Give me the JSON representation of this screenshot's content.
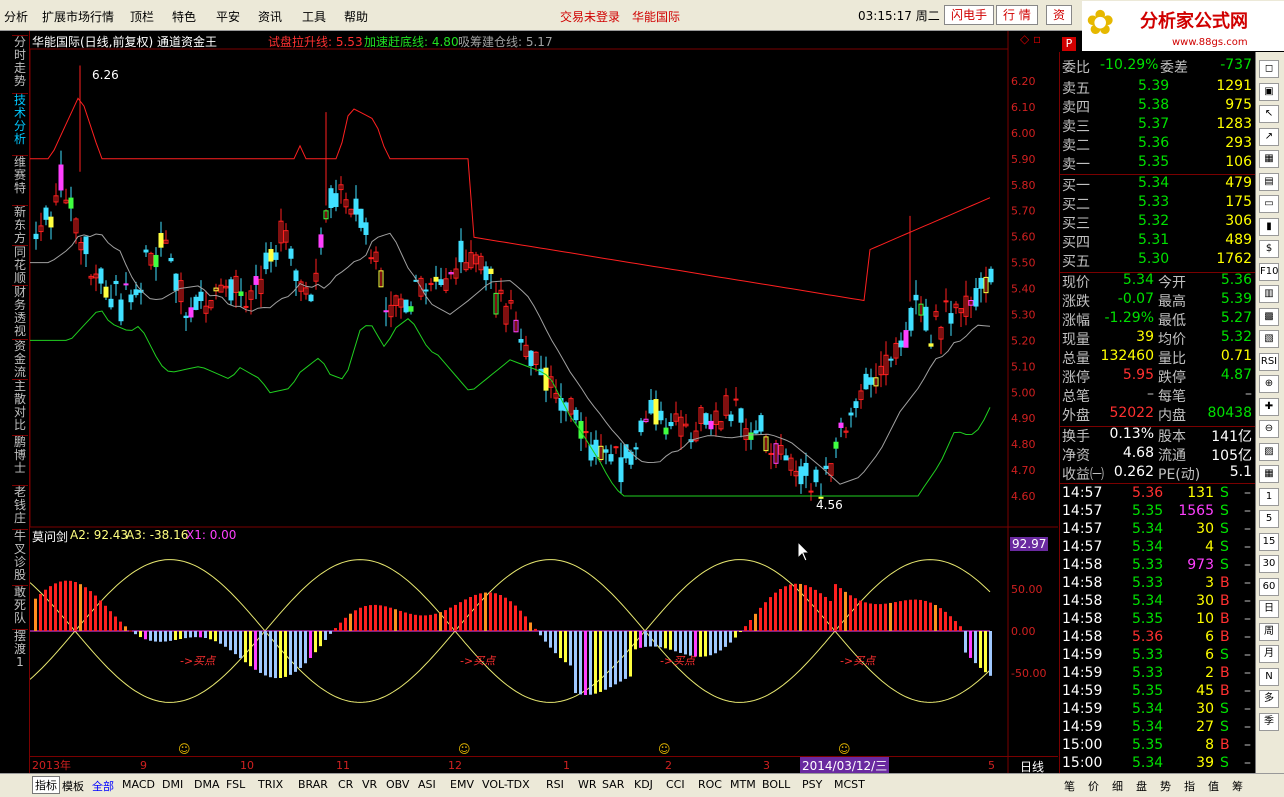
{
  "menu": {
    "items": [
      "分析",
      "扩展市场行情",
      "顶栏",
      "特色",
      "平安",
      "资讯",
      "工具",
      "帮助"
    ],
    "status_login": "交易未登录",
    "status_stock": "华能国际",
    "clock": "03:15:17 周二",
    "buttons": [
      "闪电手",
      "行 情",
      "资"
    ]
  },
  "logo": {
    "title": "分析家公式网",
    "url": "www.88gs.com"
  },
  "left_tabs": [
    "分时走势",
    "技术分析",
    "维赛特",
    "新东方",
    "同花顺",
    "财务透视",
    "资金流",
    "主散对比",
    "鹏博士",
    "老钱庄",
    "牛叉诊股",
    "敢死队",
    "摆渡1"
  ],
  "main_header": {
    "title": "华能国际(日线,前复权) 通道资金王",
    "l1_label": "试盘拉升线: 5.53",
    "l2_label": "加速赶底线: 4.80",
    "l3_label": "吸筹建仓线: 5.17",
    "high_mark": "6.26",
    "low_mark": "4.56"
  },
  "price_axis": [
    "6.20",
    "6.10",
    "6.00",
    "5.90",
    "5.80",
    "5.70",
    "5.60",
    "5.50",
    "5.40",
    "5.30",
    "5.20",
    "5.10",
    "5.00",
    "4.90",
    "4.80",
    "4.70",
    "4.60"
  ],
  "sub_header": {
    "name": "莫问剑",
    "a2": "A2: 92.43",
    "a3": "A3: -38.16",
    "x1": "X1: 0.00",
    "current": "92.97"
  },
  "sub_axis": [
    "50.00",
    "0.00",
    "-50.00"
  ],
  "buy_label": "->买点",
  "date_axis": {
    "labels": [
      "2013年",
      "9",
      "10",
      "11",
      "12",
      "1",
      "2",
      "3",
      "4",
      "5"
    ],
    "cursor_date": "2014/03/12/三",
    "period": "日线"
  },
  "quote": {
    "header_code": "P",
    "wei_bi_label": "委比",
    "wei_bi": "-10.29%",
    "wei_cha_label": "委差",
    "wei_cha": "-737",
    "asks": [
      {
        "label": "卖五",
        "price": "5.39",
        "vol": "1291"
      },
      {
        "label": "卖四",
        "price": "5.38",
        "vol": "975"
      },
      {
        "label": "卖三",
        "price": "5.37",
        "vol": "1283"
      },
      {
        "label": "卖二",
        "price": "5.36",
        "vol": "293"
      },
      {
        "label": "卖一",
        "price": "5.35",
        "vol": "106"
      }
    ],
    "bids": [
      {
        "label": "买一",
        "price": "5.34",
        "vol": "479"
      },
      {
        "label": "买二",
        "price": "5.33",
        "vol": "175"
      },
      {
        "label": "买三",
        "price": "5.32",
        "vol": "306"
      },
      {
        "label": "买四",
        "price": "5.31",
        "vol": "489"
      },
      {
        "label": "买五",
        "price": "5.30",
        "vol": "1762"
      }
    ],
    "stats": [
      {
        "l1": "现价",
        "v1": "5.34",
        "c1": "#00e000",
        "l2": "今开",
        "v2": "5.36",
        "c2": "#00e000"
      },
      {
        "l1": "涨跌",
        "v1": "-0.07",
        "c1": "#00e000",
        "l2": "最高",
        "v2": "5.39",
        "c2": "#00e000"
      },
      {
        "l1": "涨幅",
        "v1": "-1.29%",
        "c1": "#00e000",
        "l2": "最低",
        "v2": "5.27",
        "c2": "#00e000"
      },
      {
        "l1": "现量",
        "v1": "39",
        "c1": "#ffff00",
        "l2": "均价",
        "v2": "5.32",
        "c2": "#00e000"
      },
      {
        "l1": "总量",
        "v1": "132460",
        "c1": "#ffff00",
        "l2": "量比",
        "v2": "0.71",
        "c2": "#ffff00"
      },
      {
        "l1": "涨停",
        "v1": "5.95",
        "c1": "#ff3030",
        "l2": "跌停",
        "v2": "4.87",
        "c2": "#00e000"
      },
      {
        "l1": "总笔",
        "v1": "–",
        "c1": "#c0c0c0",
        "l2": "每笔",
        "v2": "–",
        "c2": "#c0c0c0"
      },
      {
        "l1": "外盘",
        "v1": "52022",
        "c1": "#ff3030",
        "l2": "内盘",
        "v2": "80438",
        "c2": "#00e000"
      }
    ],
    "fund": [
      {
        "l1": "换手",
        "v1": "0.13%",
        "l2": "股本",
        "v2": "141亿"
      },
      {
        "l1": "净资",
        "v1": "4.68",
        "l2": "流通",
        "v2": "105亿"
      },
      {
        "l1": "收益㈠",
        "v1": "0.262",
        "l2": "PE(动)",
        "v2": "5.1"
      }
    ],
    "ticks": [
      {
        "t": "14:57",
        "p": "5.36",
        "v": "131",
        "s": "S"
      },
      {
        "t": "14:57",
        "p": "5.35",
        "v": "1565",
        "s": "S"
      },
      {
        "t": "14:57",
        "p": "5.34",
        "v": "30",
        "s": "S"
      },
      {
        "t": "14:57",
        "p": "5.34",
        "v": "4",
        "s": "S"
      },
      {
        "t": "14:58",
        "p": "5.33",
        "v": "973",
        "s": "S"
      },
      {
        "t": "14:58",
        "p": "5.33",
        "v": "3",
        "s": "B"
      },
      {
        "t": "14:58",
        "p": "5.34",
        "v": "30",
        "s": "B"
      },
      {
        "t": "14:58",
        "p": "5.35",
        "v": "10",
        "s": "B"
      },
      {
        "t": "14:58",
        "p": "5.36",
        "v": "6",
        "s": "B"
      },
      {
        "t": "14:59",
        "p": "5.33",
        "v": "6",
        "s": "S"
      },
      {
        "t": "14:59",
        "p": "5.33",
        "v": "2",
        "s": "B"
      },
      {
        "t": "14:59",
        "p": "5.35",
        "v": "45",
        "s": "B"
      },
      {
        "t": "14:59",
        "p": "5.34",
        "v": "30",
        "s": "S"
      },
      {
        "t": "14:59",
        "p": "5.34",
        "v": "27",
        "s": "S"
      },
      {
        "t": "15:00",
        "p": "5.35",
        "v": "8",
        "s": "B"
      },
      {
        "t": "15:00",
        "p": "5.34",
        "v": "39",
        "s": "S"
      }
    ]
  },
  "tools": [
    "◻",
    "▣",
    "↖",
    "↗",
    "▦",
    "▤",
    "▭",
    "▮",
    "$",
    "F10",
    "▥",
    "▩",
    "▧",
    "RSI",
    "⊕",
    "✚",
    "⊖",
    "▨",
    "▦",
    "1",
    "5",
    "15",
    "30",
    "60",
    "日",
    "周",
    "月",
    "N",
    "多",
    "季"
  ],
  "bottom_tabs": [
    "指标",
    "模板",
    "全部",
    "MACD",
    "DMI",
    "DMA",
    "FSL",
    "TRIX",
    "BRAR",
    "CR",
    "VR",
    "OBV",
    "ASI",
    "EMV",
    "VOL-TDX",
    "RSI",
    "WR",
    "SAR",
    "KDJ",
    "CCI",
    "ROC",
    "MTM",
    "BOLL",
    "PSY",
    "MCST"
  ],
  "bottom_right_tabs": [
    "笔",
    "价",
    "细",
    "盘",
    "势",
    "指",
    "值",
    "筹"
  ],
  "colors": {
    "up": "#ff2020",
    "down": "#40e0ff",
    "upper_band": "#ff2020",
    "mid_band": "#a0a0a0",
    "low_band": "#20d020",
    "sine": "#e8e870",
    "accent": "#d00000"
  }
}
